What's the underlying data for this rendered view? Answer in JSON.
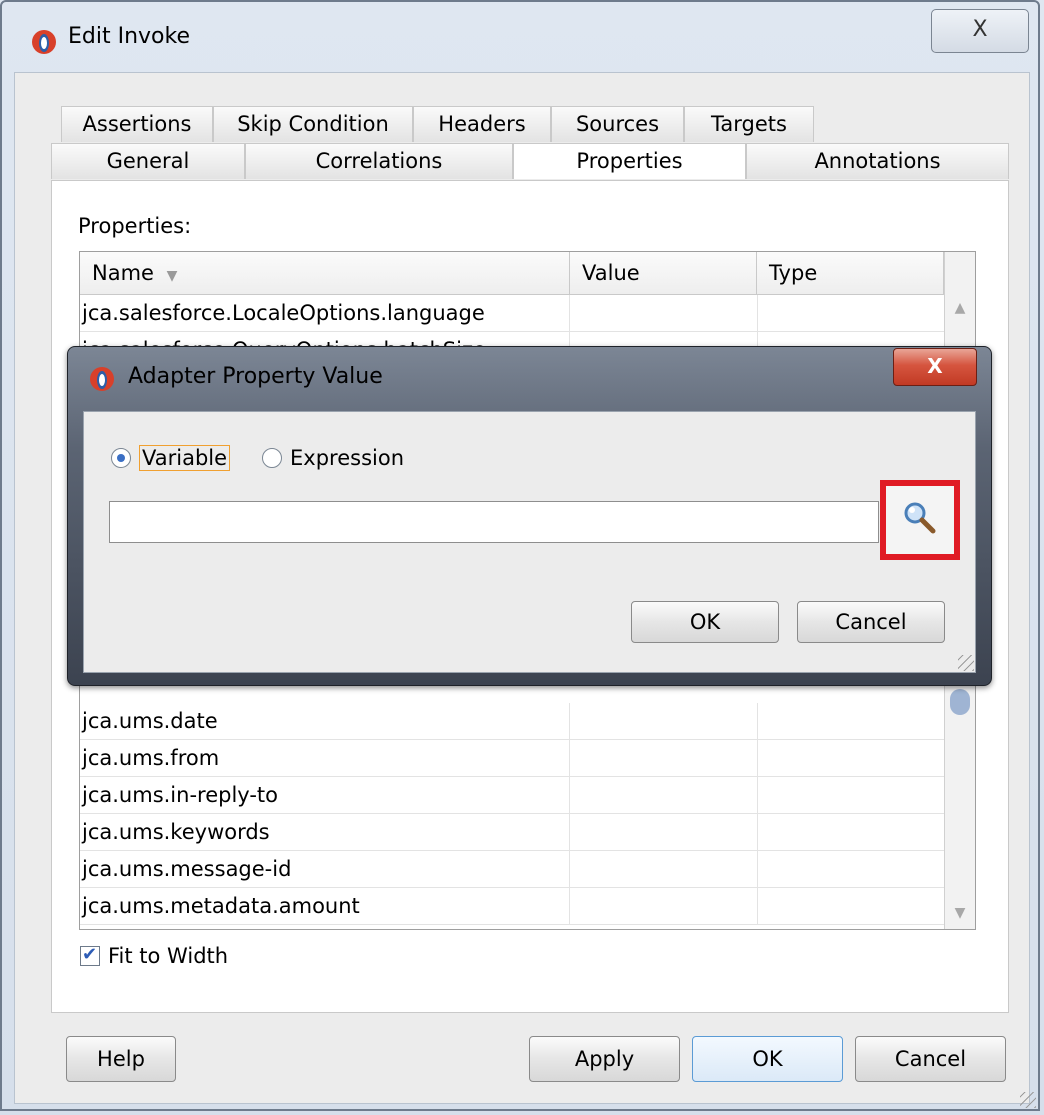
{
  "window": {
    "title": "Edit Invoke",
    "close_glyph": "X",
    "tabs_row1": [
      "Assertions",
      "Skip Condition",
      "Headers",
      "Sources",
      "Targets"
    ],
    "tabs_row2": [
      "General",
      "Correlations",
      "Properties",
      "Annotations"
    ],
    "active_tab": "Properties"
  },
  "properties": {
    "label": "Properties:",
    "columns": [
      "Name",
      "Value",
      "Type"
    ],
    "rows_top": [
      "jca.salesforce.LocaleOptions.language",
      "jca.salesforce.QueryOptions.batchSize"
    ],
    "rows_bottom": [
      "jca.ums.date",
      "jca.ums.from",
      "jca.ums.in-reply-to",
      "jca.ums.keywords",
      "jca.ums.message-id",
      "jca.ums.metadata.amount"
    ],
    "fit_to_width_label": "Fit to Width",
    "fit_to_width_checked": true
  },
  "footer": {
    "help": "Help",
    "apply": "Apply",
    "ok": "OK",
    "cancel": "Cancel"
  },
  "dialog": {
    "title": "Adapter Property Value",
    "close_glyph": "X",
    "option_variable": "Variable",
    "option_expression": "Expression",
    "selected_option": "Variable",
    "value": "",
    "search_icon": "search-icon",
    "ok": "OK",
    "cancel": "Cancel",
    "highlight_color": "#e01b24"
  }
}
